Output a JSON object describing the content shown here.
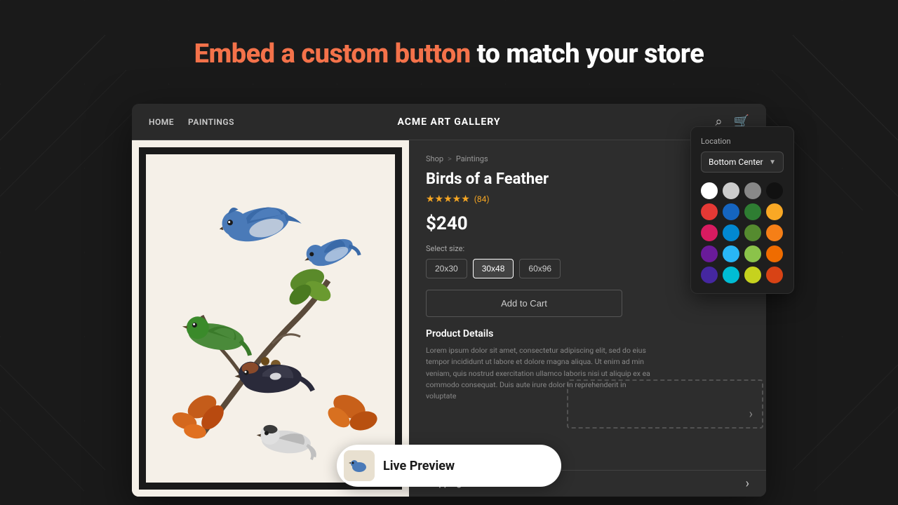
{
  "page": {
    "background_color": "#1a1a1a"
  },
  "hero": {
    "heading_highlight": "Embed a custom button",
    "heading_rest": " to match your store",
    "heading_color_highlight": "#f4724a",
    "heading_color_rest": "#ffffff"
  },
  "store": {
    "nav": {
      "links": [
        "HOME",
        "PAINTINGS"
      ],
      "title": "ACME ART GALLERY"
    },
    "breadcrumb": {
      "shop": "Shop",
      "separator": ">",
      "category": "Paintings"
    },
    "product": {
      "title": "Birds of a Feather",
      "stars": "★★★★★",
      "review_count": "(84)",
      "price": "$240",
      "size_label": "Select size:",
      "sizes": [
        "20x30",
        "30x48",
        "60x96"
      ],
      "active_size": "30x48",
      "add_to_cart": "Add to Cart",
      "details_heading": "Product Details",
      "description": "Lorem ipsum dolor sit amet, consectetur adipiscing elit, sed do eius tempor incididunt ut labore et dolore magna aliqua. Ut enim ad min veniam, quis nostrud exercitation ullamco laboris nisi ut aliquip ex ea commodo consequat. Duis aute irure dolor in reprehenderit in voluptate"
    }
  },
  "live_preview": {
    "label": "Live Preview"
  },
  "color_picker": {
    "location_label": "Location",
    "location_value": "Bottom Center",
    "colors": [
      {
        "id": "white",
        "hex": "#ffffff",
        "selected": true
      },
      {
        "id": "light-gray",
        "hex": "#cccccc",
        "selected": false
      },
      {
        "id": "gray",
        "hex": "#888888",
        "selected": false
      },
      {
        "id": "black",
        "hex": "#111111",
        "selected": false
      },
      {
        "id": "red",
        "hex": "#e53935",
        "selected": false
      },
      {
        "id": "blue",
        "hex": "#1565c0",
        "selected": false
      },
      {
        "id": "green",
        "hex": "#2e7d32",
        "selected": false
      },
      {
        "id": "yellow",
        "hex": "#f9a825",
        "selected": false
      },
      {
        "id": "pink",
        "hex": "#d81b60",
        "selected": false
      },
      {
        "id": "light-blue",
        "hex": "#0288d1",
        "selected": false
      },
      {
        "id": "lime-green",
        "hex": "#558b2f",
        "selected": false
      },
      {
        "id": "amber",
        "hex": "#f57f17",
        "selected": false
      },
      {
        "id": "purple",
        "hex": "#6a1b9a",
        "selected": false
      },
      {
        "id": "sky-blue",
        "hex": "#29b6f6",
        "selected": false
      },
      {
        "id": "yellow-green",
        "hex": "#8bc34a",
        "selected": false
      },
      {
        "id": "orange",
        "hex": "#ef6c00",
        "selected": false
      },
      {
        "id": "deep-purple",
        "hex": "#4527a0",
        "selected": false
      },
      {
        "id": "cyan",
        "hex": "#00bcd4",
        "selected": false
      },
      {
        "id": "olive",
        "hex": "#c6d21e",
        "selected": false
      },
      {
        "id": "deep-orange",
        "hex": "#d84315",
        "selected": false
      }
    ]
  },
  "shipping": {
    "label": "Shipping & Returns",
    "arrow": "›"
  }
}
